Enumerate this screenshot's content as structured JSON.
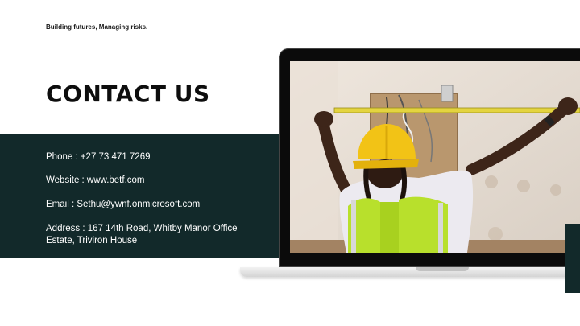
{
  "tagline": "Building futures, Managing risks.",
  "title": "CONTACT US",
  "contact": {
    "phone": "Phone : +27 73 471 7269",
    "website": "Website : www.betf.com",
    "email": "Email : Sethu@ywnf.onmicrosoft.com",
    "address_line1": "Address : 167 14th Road, Whitby Manor Office",
    "address_line2": "Estate, Triviron House"
  },
  "colors": {
    "band": "#12292a",
    "helmet": "#f2c316",
    "vest": "#b8e02c",
    "wall": "#e6dcd2"
  }
}
